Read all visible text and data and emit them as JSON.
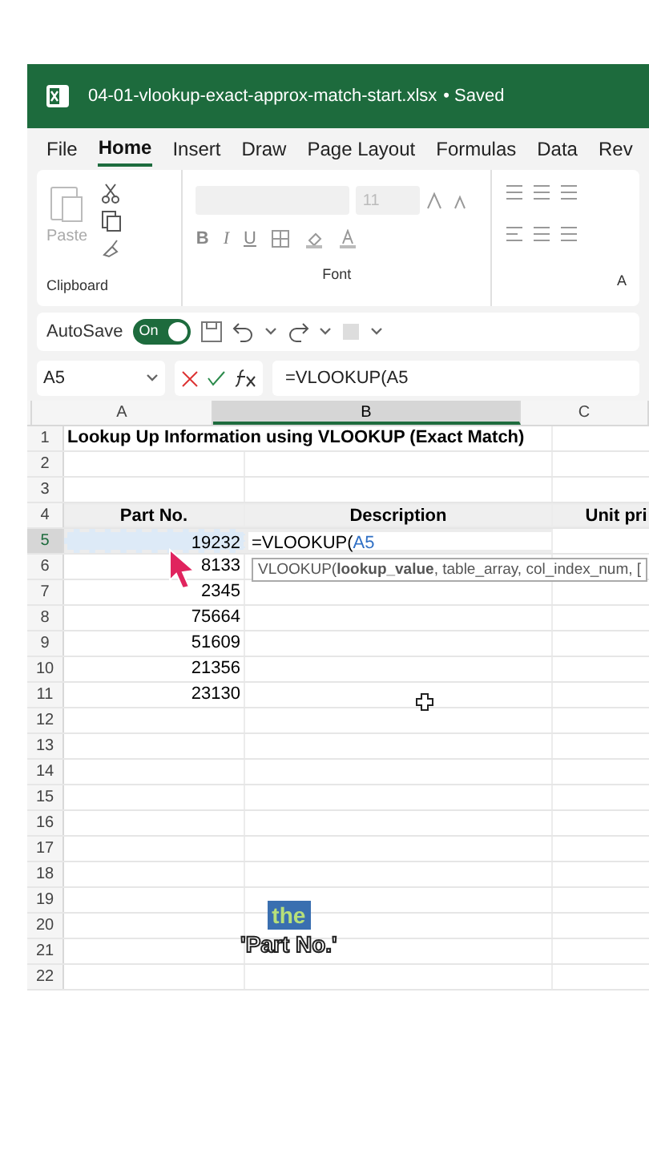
{
  "title_bar": {
    "file_name": "04-01-vlookup-exact-approx-match-start.xlsx",
    "status": "• Saved"
  },
  "tabs": [
    {
      "label": "File",
      "selected": false
    },
    {
      "label": "Home",
      "selected": true
    },
    {
      "label": "Insert",
      "selected": false
    },
    {
      "label": "Draw",
      "selected": false
    },
    {
      "label": "Page Layout",
      "selected": false
    },
    {
      "label": "Formulas",
      "selected": false
    },
    {
      "label": "Data",
      "selected": false
    },
    {
      "label": "Rev",
      "selected": false
    }
  ],
  "ribbon": {
    "paste_label": "Paste",
    "font_size": "11",
    "bold": "B",
    "italic": "I",
    "underline": "U",
    "groups": [
      "Clipboard",
      "Font",
      "A"
    ]
  },
  "autosave": {
    "label": "AutoSave",
    "on": true,
    "state_label": "On"
  },
  "name_box": "A5",
  "formula": "=VLOOKUP(A5",
  "columns": [
    {
      "label": "A",
      "selected": false
    },
    {
      "label": "B",
      "selected": true
    },
    {
      "label": "C",
      "selected": false
    }
  ],
  "rows": [
    {
      "number": "1",
      "selected": false,
      "kind": "title",
      "cells": [
        "Lookup Up Information using VLOOKUP (Exact Match)",
        "",
        ""
      ]
    },
    {
      "number": "2",
      "selected": false,
      "kind": "data",
      "cells": [
        "",
        "",
        ""
      ]
    },
    {
      "number": "3",
      "selected": false,
      "kind": "data",
      "cells": [
        "",
        "",
        ""
      ]
    },
    {
      "number": "4",
      "selected": false,
      "kind": "header",
      "cells": [
        "Part No.",
        "Description",
        "Unit pri"
      ]
    },
    {
      "number": "5",
      "selected": true,
      "kind": "active",
      "cells": [
        "19232",
        "=VLOOKUP(",
        ""
      ],
      "ref": "A5"
    },
    {
      "number": "6",
      "selected": false,
      "kind": "data",
      "cells": [
        "8133",
        "",
        ""
      ]
    },
    {
      "number": "7",
      "selected": false,
      "kind": "data",
      "cells": [
        "2345",
        "",
        ""
      ]
    },
    {
      "number": "8",
      "selected": false,
      "kind": "data",
      "cells": [
        "75664",
        "",
        ""
      ]
    },
    {
      "number": "9",
      "selected": false,
      "kind": "data",
      "cells": [
        "51609",
        "",
        ""
      ]
    },
    {
      "number": "10",
      "selected": false,
      "kind": "data",
      "cells": [
        "21356",
        "",
        ""
      ]
    },
    {
      "number": "11",
      "selected": false,
      "kind": "data",
      "cells": [
        "23130",
        "",
        ""
      ]
    },
    {
      "number": "12",
      "selected": false,
      "kind": "data",
      "cells": [
        "",
        "",
        ""
      ]
    },
    {
      "number": "13",
      "selected": false,
      "kind": "data",
      "cells": [
        "",
        "",
        ""
      ]
    },
    {
      "number": "14",
      "selected": false,
      "kind": "data",
      "cells": [
        "",
        "",
        ""
      ]
    },
    {
      "number": "15",
      "selected": false,
      "kind": "data",
      "cells": [
        "",
        "",
        ""
      ]
    },
    {
      "number": "16",
      "selected": false,
      "kind": "data",
      "cells": [
        "",
        "",
        ""
      ]
    },
    {
      "number": "17",
      "selected": false,
      "kind": "data",
      "cells": [
        "",
        "",
        ""
      ]
    },
    {
      "number": "18",
      "selected": false,
      "kind": "data",
      "cells": [
        "",
        "",
        ""
      ]
    },
    {
      "number": "19",
      "selected": false,
      "kind": "data",
      "cells": [
        "",
        "",
        ""
      ]
    },
    {
      "number": "20",
      "selected": false,
      "kind": "data",
      "cells": [
        "",
        "",
        ""
      ]
    },
    {
      "number": "21",
      "selected": false,
      "kind": "data",
      "cells": [
        "",
        "",
        ""
      ]
    },
    {
      "number": "22",
      "selected": false,
      "kind": "data",
      "cells": [
        "",
        "",
        ""
      ]
    }
  ],
  "tooltip": "VLOOKUP(**lookup_value**, table_array, col_index_num, [",
  "captions": [
    {
      "text": "the",
      "highlighted": true
    },
    {
      "text": "'Part No.'",
      "highlighted": false
    }
  ]
}
